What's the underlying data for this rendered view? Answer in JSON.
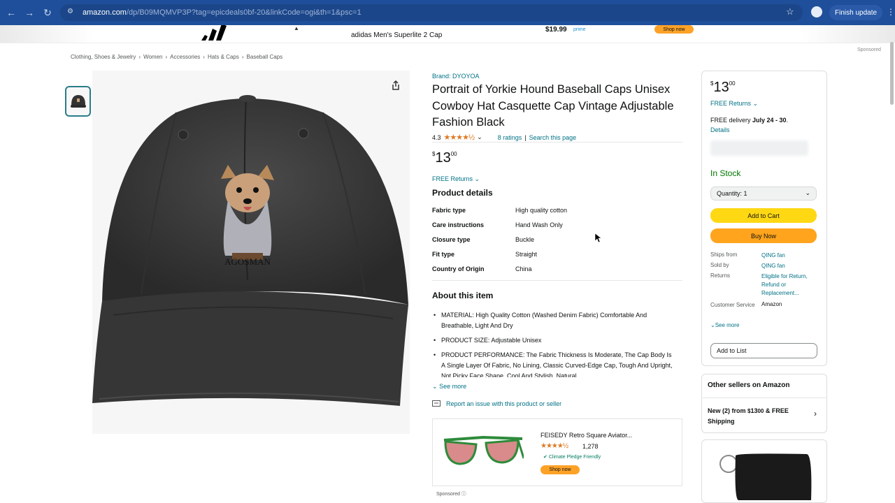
{
  "browser": {
    "url_host": "amazon.com",
    "url_path": "/dp/B09MQMVP3P?tag=epicdeals0bf-20&linkCode=ogi&th=1&psc=1",
    "finish_update": "Finish update"
  },
  "banner": {
    "product": "adidas Men's Superlite 2 Cap",
    "price": "$19.99",
    "prime": "prime",
    "shop": "Shop now"
  },
  "sponsored_top": "Sponsored",
  "breadcrumb": [
    "Clothing, Shoes & Jewelry",
    "›",
    "Women",
    "›",
    "Accessories",
    "›",
    "Hats & Caps",
    "›",
    "Baseball Caps"
  ],
  "product": {
    "brand": "Brand: DYOYOA",
    "title": "Portrait of Yorkie Hound Baseball Caps Unisex Cowboy Hat Casquette Cap Vintage Adjustable Fashion Black",
    "rating": "4.3",
    "stars": "★★★★½",
    "ratings_count": "8 ratings",
    "separator": "|",
    "search_page": "Search this page",
    "price_symbol": "$",
    "price_whole": "13",
    "price_fraction": "00",
    "free_returns": "FREE Returns",
    "details_title": "Product details",
    "details": [
      {
        "key": "Fabric type",
        "value": "High quality cotton"
      },
      {
        "key": "Care instructions",
        "value": "Hand Wash Only"
      },
      {
        "key": "Closure type",
        "value": "Buckle"
      },
      {
        "key": "Fit type",
        "value": "Straight"
      },
      {
        "key": "Country of Origin",
        "value": "China"
      }
    ],
    "about_title": "About this item",
    "bullets": [
      "MATERIAL: High Quality Cotton (Washed Denim Fabric) Comfortable And Breathable, Light And Dry",
      "PRODUCT SIZE: Adjustable Unisex",
      "PRODUCT PERFORMANCE: The Fabric Thickness Is Moderate, The Cap Body Is A Single Layer Of Fabric, No Lining, Classic Curved-Edge Cap, Tough And Upright, Not Picky Face Shape, Cool And Stylish, Natural"
    ],
    "see_more": "See more",
    "report": "Report an issue with this product or seller",
    "cap_text": "AGOSMAN"
  },
  "ad": {
    "title": "FEISEDY Retro Square Aviator...",
    "stars": "★★★★½",
    "count": "1,278",
    "climate": "Climate Pledge Friendly",
    "shop": "Shop now",
    "sponsored": "Sponsored ⓘ"
  },
  "buybox": {
    "price_symbol": "$",
    "price_whole": "13",
    "price_fraction": "00",
    "free_returns": "FREE Returns",
    "delivery_prefix": "FREE delivery ",
    "delivery_dates": "July 24 - 30",
    "delivery_suffix": ".",
    "details": "Details",
    "in_stock": "In Stock",
    "quantity": "Quantity: 1",
    "add_to_cart": "Add to Cart",
    "buy_now": "Buy Now",
    "ships_from_label": "Ships from",
    "ships_from": "QING fan",
    "sold_by_label": "Sold by",
    "sold_by": "QING fan",
    "returns_label": "Returns",
    "returns": "Eligible for Return, Refund or Replacement...",
    "service_label": "Customer Service",
    "service": "Amazon",
    "see_more": "See more",
    "add_to_list": "Add to List"
  },
  "other_sellers": {
    "title": "Other sellers on Amazon",
    "new_text_1": "New (2) from ",
    "new_price_symbol": "$",
    "new_price": "13",
    "new_price_fraction": "00",
    "new_text_2": " & FREE Shipping"
  }
}
